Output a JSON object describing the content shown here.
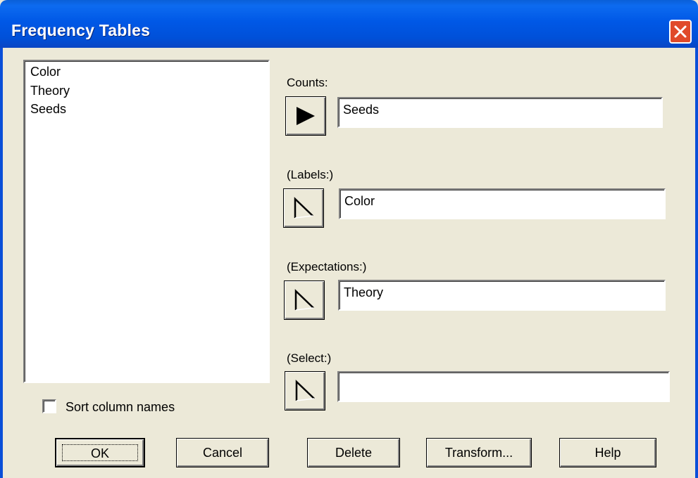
{
  "window": {
    "title": "Frequency Tables",
    "title_bar_color": "#0058e6",
    "close_button_color": "#e04a2a",
    "background_color": "#ece9d8"
  },
  "column_list": {
    "items": [
      "Color",
      "Theory",
      "Seeds"
    ]
  },
  "sort_option": {
    "label": "Sort column names",
    "checked": false
  },
  "fields": {
    "counts": {
      "label": "Counts:",
      "value": "Seeds",
      "arrow_state": "filled"
    },
    "labels": {
      "label": "(Labels:)",
      "value": "Color",
      "arrow_state": "outline"
    },
    "expectations": {
      "label": "(Expectations:)",
      "value": "Theory",
      "arrow_state": "outline"
    },
    "select": {
      "label": "(Select:)",
      "value": "",
      "arrow_state": "outline"
    }
  },
  "buttons": {
    "ok": "OK",
    "cancel": "Cancel",
    "delete": "Delete",
    "transform": "Transform...",
    "help": "Help"
  },
  "icons": {
    "close": "close-icon",
    "filled_arrow": "play-arrow-icon",
    "outline_arrow": "outline-arrow-icon"
  }
}
